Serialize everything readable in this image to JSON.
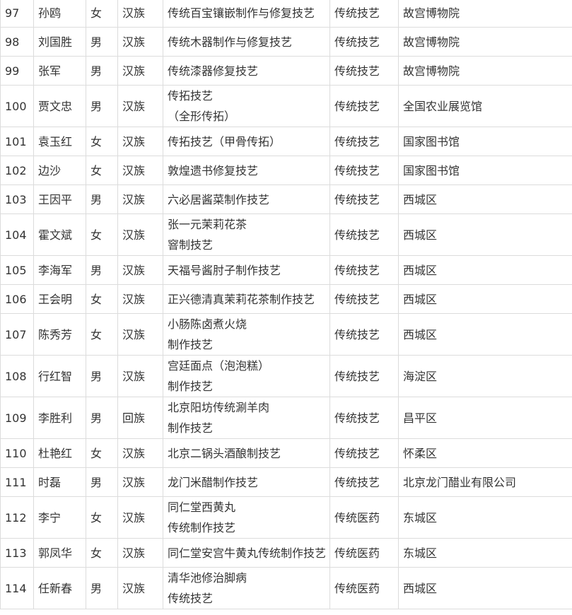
{
  "rows": [
    {
      "no": "97",
      "name": "孙鸥",
      "sex": "女",
      "ethnic": "汉族",
      "project": [
        "传统百宝镶嵌制作与修复技艺"
      ],
      "category": "传统技艺",
      "unit": "故宫博物院"
    },
    {
      "no": "98",
      "name": "刘国胜",
      "sex": "男",
      "ethnic": "汉族",
      "project": [
        "传统木器制作与修复技艺"
      ],
      "category": "传统技艺",
      "unit": "故宫博物院"
    },
    {
      "no": "99",
      "name": "张军",
      "sex": "男",
      "ethnic": "汉族",
      "project": [
        "传统漆器修复技艺"
      ],
      "category": "传统技艺",
      "unit": "故宫博物院"
    },
    {
      "no": "100",
      "name": "贾文忠",
      "sex": "男",
      "ethnic": "汉族",
      "project": [
        "传拓技艺",
        "（全形传拓）"
      ],
      "category": "传统技艺",
      "unit": "全国农业展览馆"
    },
    {
      "no": "101",
      "name": "袁玉红",
      "sex": "女",
      "ethnic": "汉族",
      "project": [
        "传拓技艺（甲骨传拓）"
      ],
      "category": "传统技艺",
      "unit": "国家图书馆"
    },
    {
      "no": "102",
      "name": "边沙",
      "sex": "女",
      "ethnic": "汉族",
      "project": [
        "敦煌遗书修复技艺"
      ],
      "category": "传统技艺",
      "unit": "国家图书馆"
    },
    {
      "no": "103",
      "name": "王因平",
      "sex": "男",
      "ethnic": "汉族",
      "project": [
        "六必居酱菜制作技艺"
      ],
      "category": "传统技艺",
      "unit": "西城区"
    },
    {
      "no": "104",
      "name": "霍文斌",
      "sex": "女",
      "ethnic": "汉族",
      "project": [
        "张一元茉莉花茶",
        "窨制技艺"
      ],
      "category": "传统技艺",
      "unit": "西城区"
    },
    {
      "no": "105",
      "name": "李海军",
      "sex": "男",
      "ethnic": "汉族",
      "project": [
        "天福号酱肘子制作技艺"
      ],
      "category": "传统技艺",
      "unit": "西城区"
    },
    {
      "no": "106",
      "name": "王会明",
      "sex": "女",
      "ethnic": "汉族",
      "project": [
        "正兴德清真茉莉花茶制作技艺"
      ],
      "category": "传统技艺",
      "unit": "西城区"
    },
    {
      "no": "107",
      "name": "陈秀芳",
      "sex": "女",
      "ethnic": "汉族",
      "project": [
        "小肠陈卤煮火烧",
        "制作技艺"
      ],
      "category": "传统技艺",
      "unit": "西城区"
    },
    {
      "no": "108",
      "name": "行红智",
      "sex": "男",
      "ethnic": "汉族",
      "project": [
        "宫廷面点（泡泡糕）",
        "制作技艺"
      ],
      "category": "传统技艺",
      "unit": "海淀区"
    },
    {
      "no": "109",
      "name": "李胜利",
      "sex": "男",
      "ethnic": "回族",
      "project": [
        "北京阳坊传统涮羊肉",
        "制作技艺"
      ],
      "category": "传统技艺",
      "unit": "昌平区"
    },
    {
      "no": "110",
      "name": "杜艳红",
      "sex": "女",
      "ethnic": "汉族",
      "project": [
        "北京二锅头酒酿制技艺"
      ],
      "category": "传统技艺",
      "unit": "怀柔区"
    },
    {
      "no": "111",
      "name": "时磊",
      "sex": "男",
      "ethnic": "汉族",
      "project": [
        "龙门米醋制作技艺"
      ],
      "category": "传统技艺",
      "unit": "北京龙门醋业有限公司"
    },
    {
      "no": "112",
      "name": "李宁",
      "sex": "女",
      "ethnic": "汉族",
      "project": [
        "同仁堂西黄丸",
        "传统制作技艺"
      ],
      "category": "传统医药",
      "unit": "东城区"
    },
    {
      "no": "113",
      "name": "郭凤华",
      "sex": "女",
      "ethnic": "汉族",
      "project": [
        "同仁堂安宫牛黄丸传统制作技艺"
      ],
      "category": "传统医药",
      "unit": "东城区"
    },
    {
      "no": "114",
      "name": "任新春",
      "sex": "男",
      "ethnic": "汉族",
      "project": [
        "清华池修治脚病",
        "传统技艺"
      ],
      "category": "传统医药",
      "unit": "西城区"
    }
  ]
}
